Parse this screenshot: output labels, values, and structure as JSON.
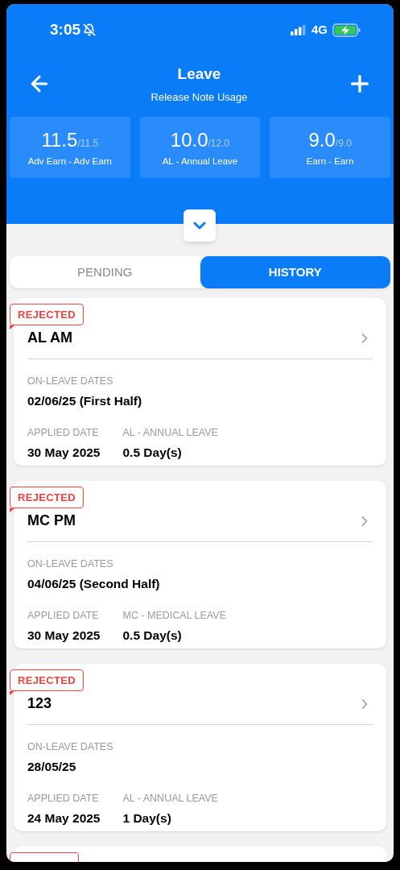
{
  "status_bar": {
    "time": "3:05",
    "network": "4G"
  },
  "header": {
    "title": "Leave",
    "subtitle": "Release Note Usage"
  },
  "balances": [
    {
      "value": "11.5",
      "total": "/11.5",
      "label": "Adv Earn - Adv Earn"
    },
    {
      "value": "10.0",
      "total": "/12.0",
      "label": "AL - Annual Leave"
    },
    {
      "value": "9.0",
      "total": "/9.0",
      "label": "Earn - Earn"
    }
  ],
  "tabs": [
    {
      "label": "PENDING",
      "selected": false
    },
    {
      "label": "HISTORY",
      "selected": true
    }
  ],
  "requests": [
    {
      "status": "REJECTED",
      "title": "AL AM",
      "dates_label": "ON-LEAVE DATES",
      "dates": "02/06/25 (First Half)",
      "applied_label": "APPLIED DATE",
      "applied": "30 May 2025",
      "type_label": "AL - ANNUAL LEAVE",
      "duration": "0.5 Day(s)"
    },
    {
      "status": "REJECTED",
      "title": "MC PM",
      "dates_label": "ON-LEAVE DATES",
      "dates": "04/06/25 (Second Half)",
      "applied_label": "APPLIED DATE",
      "applied": "30 May 2025",
      "type_label": "MC - MEDICAL LEAVE",
      "duration": "0.5 Day(s)"
    },
    {
      "status": "REJECTED",
      "title": "123",
      "dates_label": "ON-LEAVE DATES",
      "dates": "28/05/25",
      "applied_label": "APPLIED DATE",
      "applied": "24 May 2025",
      "type_label": "AL - ANNUAL LEAVE",
      "duration": "1 Day(s)"
    }
  ]
}
